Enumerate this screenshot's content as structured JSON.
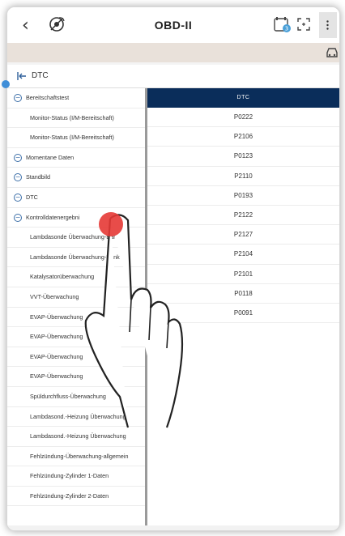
{
  "header": {
    "title": "OBD-II",
    "back_icon": "chevron-left-icon",
    "menu_icon": "kebab-menu-icon"
  },
  "section": {
    "label": "DTC"
  },
  "left_tree": [
    {
      "type": "cat",
      "text": "Bereitschaftstest"
    },
    {
      "type": "item",
      "text": "Monitor-Status (I/M-Bereitschaft)"
    },
    {
      "type": "item",
      "text": "Monitor-Status (I/M-Bereitschaft)"
    },
    {
      "type": "cat",
      "text": "Momentane Daten"
    },
    {
      "type": "cat",
      "text": "Standbild"
    },
    {
      "type": "cat",
      "text": "DTC"
    },
    {
      "type": "cat",
      "text": "Kontrolldatenergebni"
    },
    {
      "type": "item",
      "text": "Lambdasonde Überwachung-Bank"
    },
    {
      "type": "item",
      "text": "Lambdasonde Überwachung-Bank"
    },
    {
      "type": "item",
      "text": "Katalysatorüberwachung"
    },
    {
      "type": "item",
      "text": "VVT-Überwachung"
    },
    {
      "type": "item",
      "text": "EVAP-Überwachung"
    },
    {
      "type": "item",
      "text": "EVAP-Überwachung"
    },
    {
      "type": "item",
      "text": "EVAP-Überwachung"
    },
    {
      "type": "item",
      "text": "EVAP-Überwachung"
    },
    {
      "type": "item",
      "text": "Spüldurchfluss-Überwachung"
    },
    {
      "type": "item",
      "text": "Lambdasond.-Heizung Überwachung"
    },
    {
      "type": "item",
      "text": "Lambdasond.-Heizung Überwachung"
    },
    {
      "type": "item",
      "text": "Fehlzündung-Überwachung-allgemein"
    },
    {
      "type": "item",
      "text": "Fehlzündung-Zylinder 1-Daten"
    },
    {
      "type": "item",
      "text": "Fehlzündung-Zylinder 2-Daten"
    }
  ],
  "dtc_table": {
    "header": "DTC",
    "codes": [
      "P0222",
      "P2106",
      "P0123",
      "P2110",
      "P0193",
      "P2122",
      "P2127",
      "P2104",
      "P2101",
      "P0118",
      "P0091"
    ]
  },
  "colors": {
    "table_header": "#0a2d5a",
    "tree_icon": "#3b6ea8",
    "touch_point": "#e53935"
  }
}
